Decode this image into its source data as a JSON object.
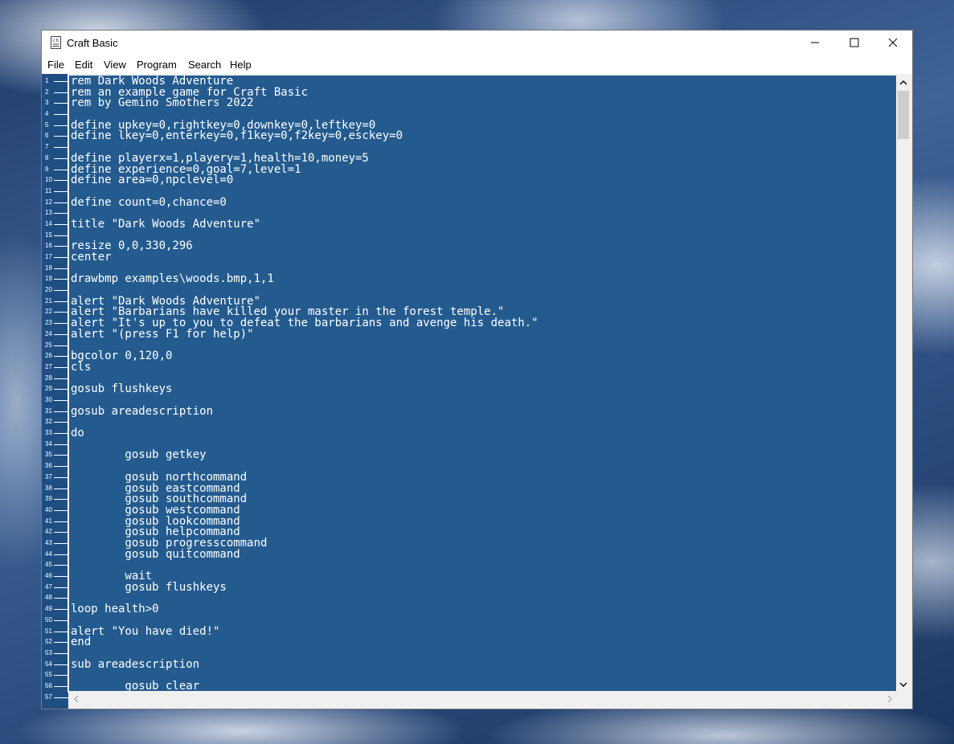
{
  "window": {
    "title": "Craft Basic",
    "app_icon_text": "CB",
    "controls": {
      "minimize": "minimize-icon",
      "maximize": "maximize-icon",
      "close": "close-icon"
    }
  },
  "menu": [
    "File",
    "Edit",
    "View",
    "Program",
    "Search",
    "Help"
  ],
  "editor": {
    "colors": {
      "background": "#245b8f",
      "gutter": "#1f4e83",
      "text": "#ffffff"
    },
    "line_numbers": [
      "1",
      "2",
      "3",
      "4",
      "5",
      "6",
      "7",
      "8",
      "9",
      "10",
      "11",
      "12",
      "13",
      "14",
      "15",
      "16",
      "17",
      "18",
      "19",
      "20",
      "21",
      "22",
      "23",
      "24",
      "25",
      "26",
      "27",
      "28",
      "29",
      "30",
      "31",
      "32",
      "33",
      "34",
      "35",
      "36",
      "37",
      "38",
      "39",
      "40",
      "41",
      "42",
      "43",
      "44",
      "45",
      "46",
      "47",
      "48",
      "49",
      "50",
      "51",
      "52",
      "53",
      "54",
      "55",
      "56",
      "57"
    ],
    "lines": [
      "rem Dark Woods Adventure",
      "rem an example game for Craft Basic",
      "rem by Gemino Smothers 2022",
      "",
      "define upkey=0,rightkey=0,downkey=0,leftkey=0",
      "define lkey=0,enterkey=0,f1key=0,f2key=0,esckey=0",
      "",
      "define playerx=1,playery=1,health=10,money=5",
      "define experience=0,goal=7,level=1",
      "define area=0,npclevel=0",
      "",
      "define count=0,chance=0",
      "",
      "title \"Dark Woods Adventure\"",
      "",
      "resize 0,0,330,296",
      "center",
      "",
      "drawbmp examples\\woods.bmp,1,1",
      "",
      "alert \"Dark Woods Adventure\"",
      "alert \"Barbarians have killed your master in the forest temple.\"",
      "alert \"It's up to you to defeat the barbarians and avenge his death.\"",
      "alert \"(press F1 for help)\"",
      "",
      "bgcolor 0,120,0",
      "cls",
      "",
      "gosub flushkeys",
      "",
      "gosub areadescription",
      "",
      "do",
      "",
      "        gosub getkey",
      "",
      "        gosub northcommand",
      "        gosub eastcommand",
      "        gosub southcommand",
      "        gosub westcommand",
      "        gosub lookcommand",
      "        gosub helpcommand",
      "        gosub progresscommand",
      "        gosub quitcommand",
      "",
      "        wait",
      "        gosub flushkeys",
      "",
      "loop health>0",
      "",
      "alert \"You have died!\"",
      "end",
      "",
      "sub areadescription",
      "",
      "        gosub clear",
      ""
    ]
  },
  "scrollbars": {
    "up": "chevron-up-icon",
    "down": "chevron-down-icon",
    "left": "chevron-left-icon",
    "right": "chevron-right-icon"
  }
}
